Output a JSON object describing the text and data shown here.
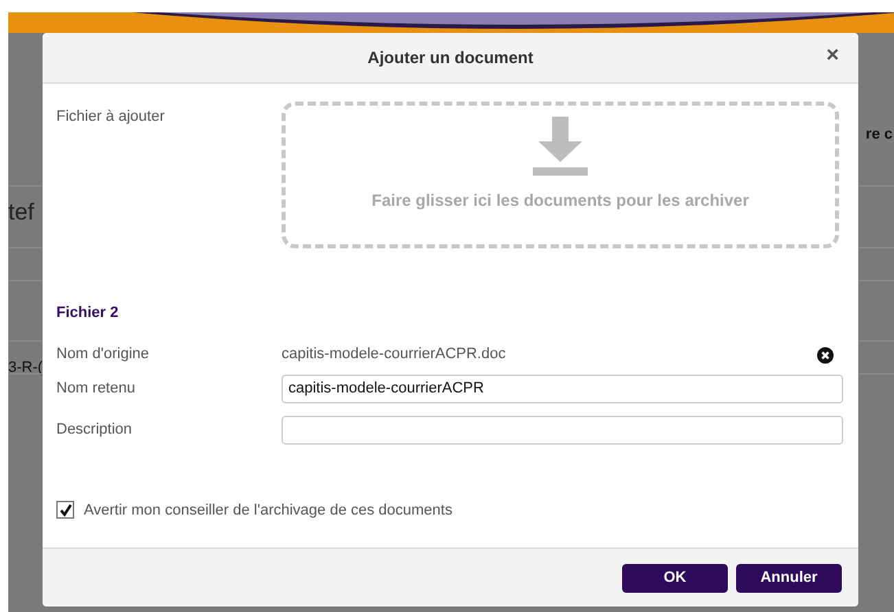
{
  "background": {
    "fragment_right": "re c",
    "fragment_left": "tef",
    "fragment_link": "3-R-("
  },
  "dialog": {
    "title": "Ajouter un document",
    "close": "×",
    "dropzone": {
      "label": "Fichier à ajouter",
      "text": "Faire glisser ici les documents pour les archiver"
    },
    "file": {
      "heading": "Fichier 2",
      "original_label": "Nom d'origine",
      "original_value": "capitis-modele-courrierACPR.doc",
      "kept_label": "Nom retenu",
      "kept_value": "capitis-modele-courrierACPR",
      "description_label": "Description"
    },
    "notify": {
      "label": "Avertir mon conseiller de l'archivage de ces documents",
      "checked": true
    },
    "buttons": [
      "OK",
      "Annuler"
    ]
  }
}
